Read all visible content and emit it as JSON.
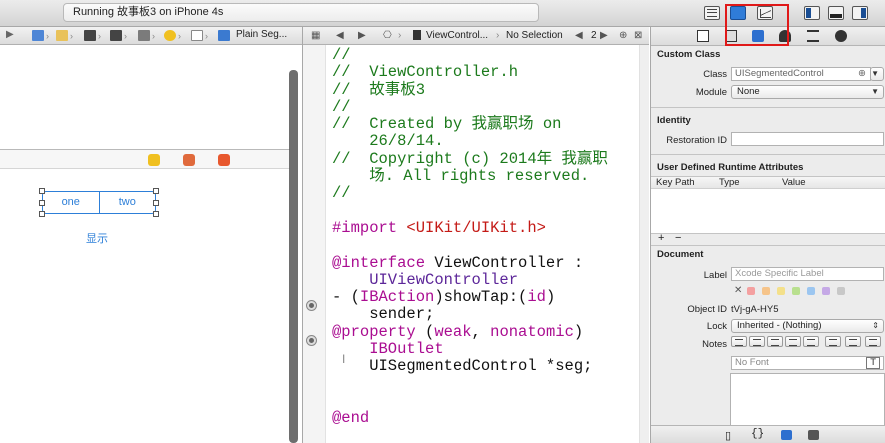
{
  "toolbar": {
    "activity_text": "Running 故事板3 on iPhone 4s"
  },
  "left_jumpbar": {
    "breadcrumb_label": "Plain Seg..."
  },
  "canvas": {
    "segments": [
      "one",
      "two"
    ],
    "label_text": "显示"
  },
  "code_jumpbar": {
    "file_label": "ViewControl...",
    "selection_label": "No Selection",
    "counter": "2"
  },
  "code_lines": [
    {
      "parts": [
        {
          "cls": "cm",
          "t": "//"
        }
      ]
    },
    {
      "parts": [
        {
          "cls": "cm",
          "t": "//  ViewController.h"
        }
      ]
    },
    {
      "parts": [
        {
          "cls": "cm",
          "t": "//  故事板3"
        }
      ]
    },
    {
      "parts": [
        {
          "cls": "cm",
          "t": "//"
        }
      ]
    },
    {
      "parts": [
        {
          "cls": "cm",
          "t": "//  Created by 我赢职场 on"
        }
      ]
    },
    {
      "parts": [
        {
          "cls": "cm",
          "t": "    26/8/14."
        }
      ]
    },
    {
      "parts": [
        {
          "cls": "cm",
          "t": "//  Copyright (c) 2014年 我赢职"
        }
      ]
    },
    {
      "parts": [
        {
          "cls": "cm",
          "t": "    场. All rights reserved."
        }
      ]
    },
    {
      "parts": [
        {
          "cls": "cm",
          "t": "//"
        }
      ]
    },
    {
      "parts": []
    },
    {
      "parts": [
        {
          "cls": "kw",
          "t": "#import "
        },
        {
          "cls": "str",
          "t": "<UIKit/UIKit.h>"
        }
      ]
    },
    {
      "parts": []
    },
    {
      "parts": [
        {
          "cls": "kw",
          "t": "@interface"
        },
        {
          "cls": "pl",
          "t": " ViewController :"
        }
      ]
    },
    {
      "parts": [
        {
          "cls": "ty",
          "t": "    UIViewController"
        }
      ]
    },
    {
      "parts": [
        {
          "cls": "pl",
          "t": "- ("
        },
        {
          "cls": "kw",
          "t": "IBAction"
        },
        {
          "cls": "pl",
          "t": ")showTap:("
        },
        {
          "cls": "kw",
          "t": "id"
        },
        {
          "cls": "pl",
          "t": ")"
        }
      ]
    },
    {
      "parts": [
        {
          "cls": "pl",
          "t": "    sender;"
        }
      ]
    },
    {
      "parts": [
        {
          "cls": "kw",
          "t": "@property"
        },
        {
          "cls": "pl",
          "t": " ("
        },
        {
          "cls": "kw",
          "t": "weak"
        },
        {
          "cls": "pl",
          "t": ", "
        },
        {
          "cls": "kw",
          "t": "nonatomic"
        },
        {
          "cls": "pl",
          "t": ")"
        }
      ]
    },
    {
      "parts": [
        {
          "cls": "kw",
          "t": "    IBOutlet"
        }
      ]
    },
    {
      "parts": [
        {
          "cls": "pl",
          "t": "    UISegmentedControl *seg;"
        }
      ]
    },
    {
      "parts": []
    },
    {
      "parts": []
    },
    {
      "parts": [
        {
          "cls": "kw",
          "t": "@end"
        }
      ]
    }
  ],
  "inspector": {
    "custom_class": {
      "title": "Custom Class",
      "class_label": "Class",
      "class_value": "UISegmentedControl",
      "module_label": "Module",
      "module_value": "None"
    },
    "identity": {
      "title": "Identity",
      "restoration_label": "Restoration ID",
      "restoration_value": ""
    },
    "runtime_attributes": {
      "title": "User Defined Runtime Attributes",
      "columns": [
        "Key Path",
        "Type",
        "Value"
      ],
      "add_symbol": "+",
      "remove_symbol": "−"
    },
    "document": {
      "title": "Document",
      "label_label": "Label",
      "label_placeholder": "Xcode Specific Label",
      "remove_symbol": "✕",
      "swatch_colors": [
        "#f4a0a0",
        "#f6c48a",
        "#f4e08a",
        "#b9e08f",
        "#9cc6f0",
        "#c5a9e6",
        "#c8c8c8"
      ],
      "object_id_label": "Object ID",
      "object_id_value": "tVj-gA-HY5",
      "lock_label": "Lock",
      "lock_value": "Inherited - (Nothing)",
      "notes_label": "Notes",
      "font_placeholder": "No Font",
      "font_button": "T"
    },
    "library_icons": [
      "file-icon",
      "braces-icon",
      "cube-icon",
      "media-icon"
    ]
  }
}
